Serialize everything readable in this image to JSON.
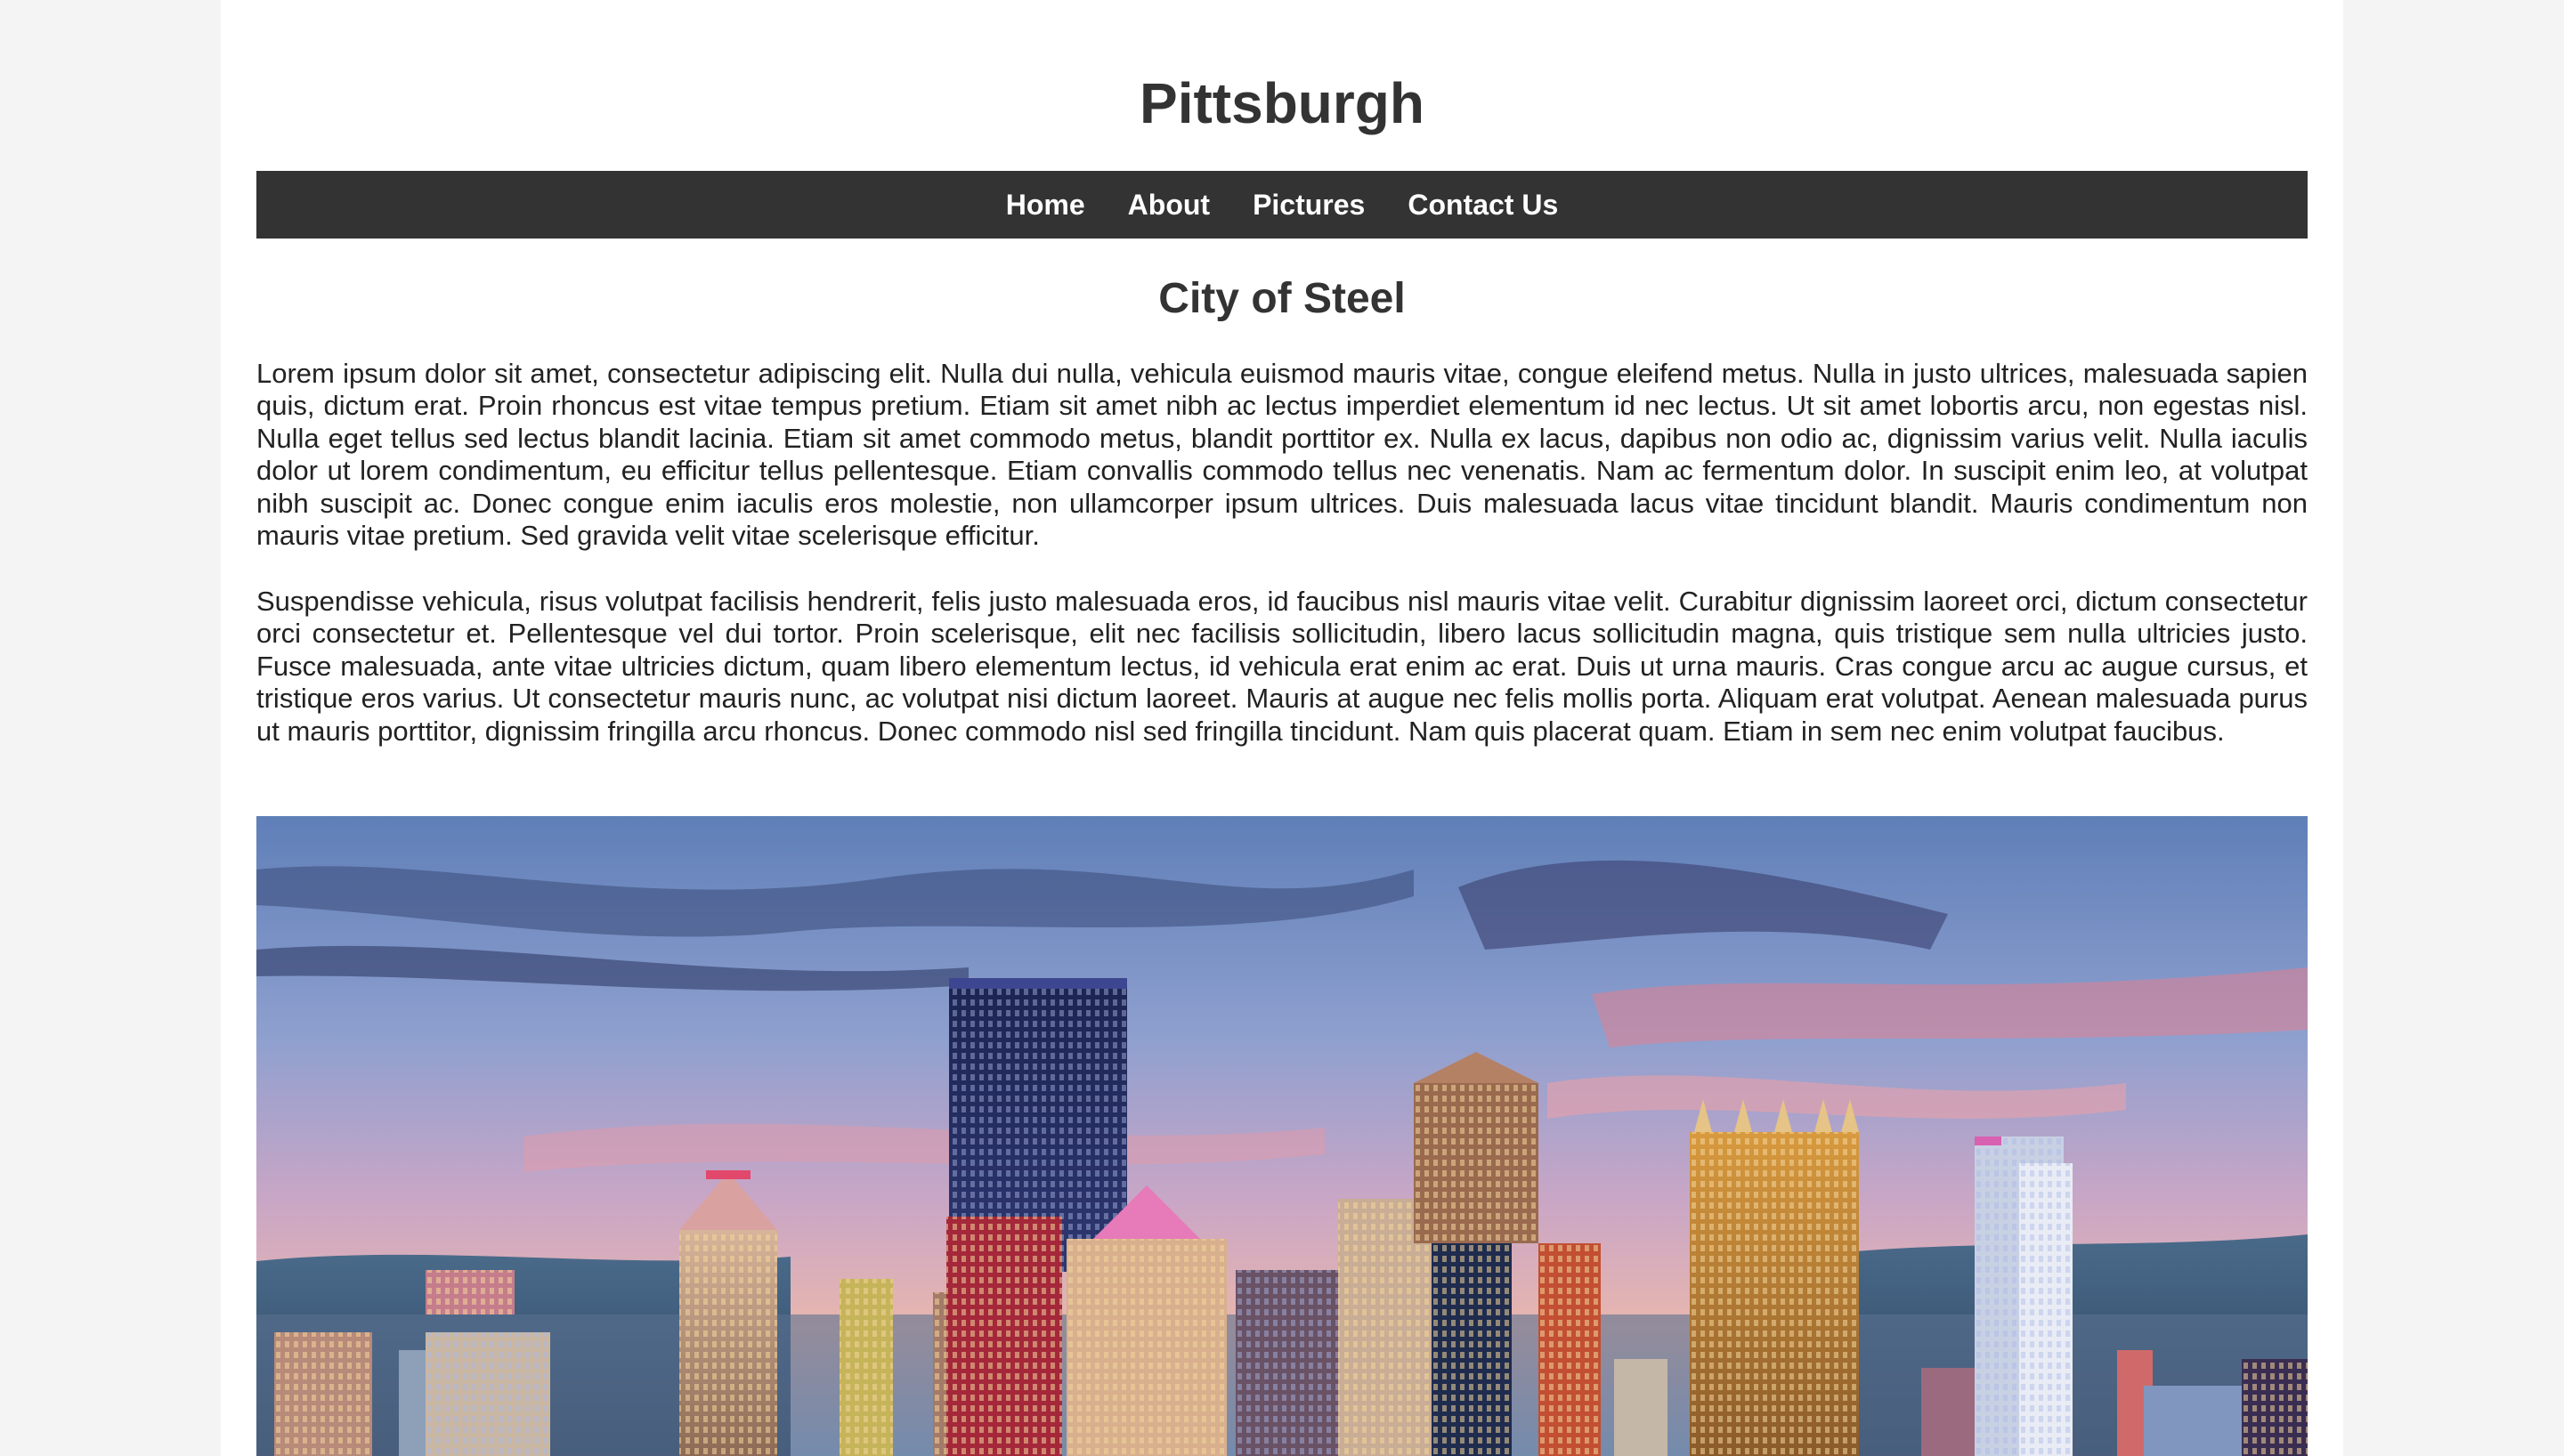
{
  "site": {
    "title": "Pittsburgh"
  },
  "nav": {
    "items": [
      {
        "label": "Home"
      },
      {
        "label": "About"
      },
      {
        "label": "Pictures"
      },
      {
        "label": "Contact Us"
      }
    ]
  },
  "main": {
    "heading": "City of Steel",
    "paragraphs": [
      "Lorem ipsum dolor sit amet, consectetur adipiscing elit. Nulla dui nulla, vehicula euismod mauris vitae, congue eleifend metus. Nulla in justo ultrices, malesuada sapien quis, dictum erat. Proin rhoncus est vitae tempus pretium. Etiam sit amet nibh ac lectus imperdiet elementum id nec lectus. Ut sit amet lobortis arcu, non egestas nisl. Nulla eget tellus sed lectus blandit lacinia. Etiam sit amet commodo metus, blandit porttitor ex. Nulla ex lacus, dapibus non odio ac, dignissim varius velit. Nulla iaculis dolor ut lorem condimentum, eu efficitur tellus pellentesque. Etiam convallis commodo tellus nec venenatis. Nam ac fermentum dolor. In suscipit enim leo, at volutpat nibh suscipit ac. Donec congue enim iaculis eros molestie, non ullamcorper ipsum ultrices. Duis malesuada lacus vitae tincidunt blandit. Mauris condimentum non mauris vitae pretium. Sed gravida velit vitae scelerisque efficitur.",
      "Suspendisse vehicula, risus volutpat facilisis hendrerit, felis justo malesuada eros, id faucibus nisl mauris vitae velit. Curabitur dignissim laoreet orci, dictum consectetur orci consectetur et. Pellentesque vel dui tortor. Proin scelerisque, elit nec facilisis sollicitudin, libero lacus sollicitudin magna, quis tristique sem nulla ultricies justo. Fusce malesuada, ante vitae ultricies dictum, quam libero elementum lectus, id vehicula erat enim ac erat. Duis ut urna mauris. Cras congue arcu ac augue cursus, et tristique eros varius. Ut consectetur mauris nunc, ac volutpat nisi dictum laoreet. Mauris at augue nec felis mollis porta. Aliquam erat volutpat. Aenean malesuada purus ut mauris porttitor, dignissim fringilla arcu rhoncus. Donec commodo nisl sed fringilla tincidunt. Nam quis placerat quam. Etiam in sem nec enim volutpat faucibus."
    ]
  },
  "colors": {
    "page_background": "#f4f4f4",
    "content_background": "#ffffff",
    "navbar": "#333333",
    "nav_text": "#ffffff",
    "heading_text": "#333333"
  }
}
